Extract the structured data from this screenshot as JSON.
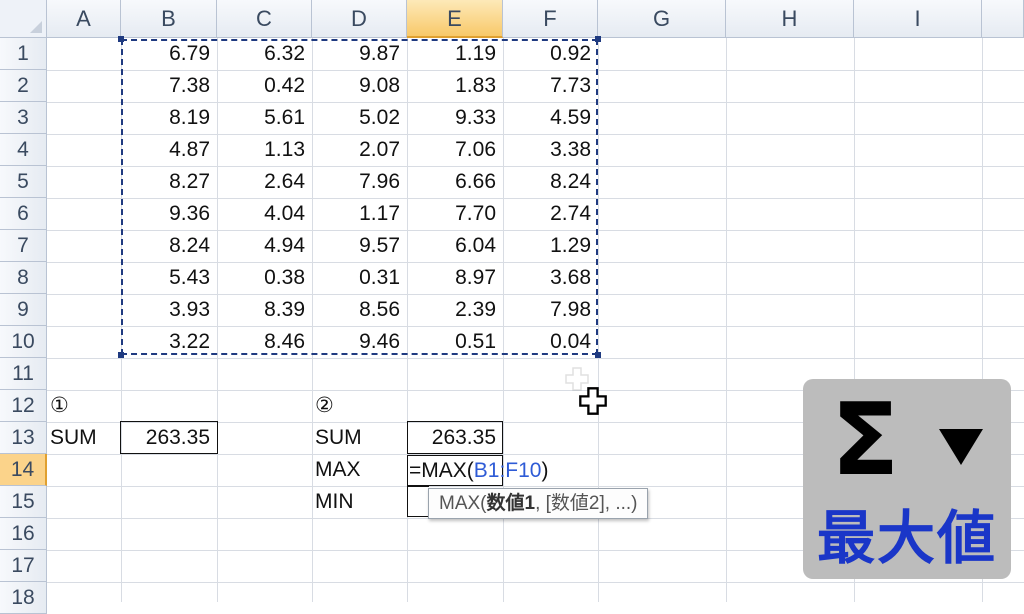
{
  "columns": [
    "A",
    "B",
    "C",
    "D",
    "E",
    "F",
    "G",
    "H",
    "I"
  ],
  "rows": [
    "1",
    "2",
    "3",
    "4",
    "5",
    "6",
    "7",
    "8",
    "9",
    "10",
    "11",
    "12",
    "13",
    "14",
    "15",
    "16",
    "17",
    "18"
  ],
  "data_table": [
    [
      "6.79",
      "6.32",
      "9.87",
      "1.19",
      "0.92"
    ],
    [
      "7.38",
      "0.42",
      "9.08",
      "1.83",
      "7.73"
    ],
    [
      "8.19",
      "5.61",
      "5.02",
      "9.33",
      "4.59"
    ],
    [
      "4.87",
      "1.13",
      "2.07",
      "7.06",
      "3.38"
    ],
    [
      "8.27",
      "2.64",
      "7.96",
      "6.66",
      "8.24"
    ],
    [
      "9.36",
      "4.04",
      "1.17",
      "7.70",
      "2.74"
    ],
    [
      "8.24",
      "4.94",
      "9.57",
      "6.04",
      "1.29"
    ],
    [
      "5.43",
      "0.38",
      "0.31",
      "8.97",
      "3.68"
    ],
    [
      "3.93",
      "8.39",
      "8.56",
      "2.39",
      "7.98"
    ],
    [
      "3.22",
      "8.46",
      "9.46",
      "0.51",
      "0.04"
    ]
  ],
  "section1": {
    "marker": "①",
    "sum_label": "SUM",
    "sum_value": "263.35"
  },
  "section2": {
    "marker": "②",
    "sum_label": "SUM",
    "sum_value": "263.35",
    "max_label": "MAX",
    "min_label": "MIN"
  },
  "formula_edit": {
    "prefix": "=MAX(",
    "ref_start": "B1",
    "ref_sep": ":",
    "ref_end": "F10",
    "suffix": ")"
  },
  "tooltip": {
    "fn": "MAX(",
    "arg1": "数値1",
    "rest": ", [数値2], ...)"
  },
  "overlay": {
    "symbol": "Σ",
    "label": "最大値"
  },
  "colors": {
    "accent_header": "#f8c96a",
    "reference_blue": "#2e5bd6",
    "overlay_label": "#1a36c8"
  }
}
